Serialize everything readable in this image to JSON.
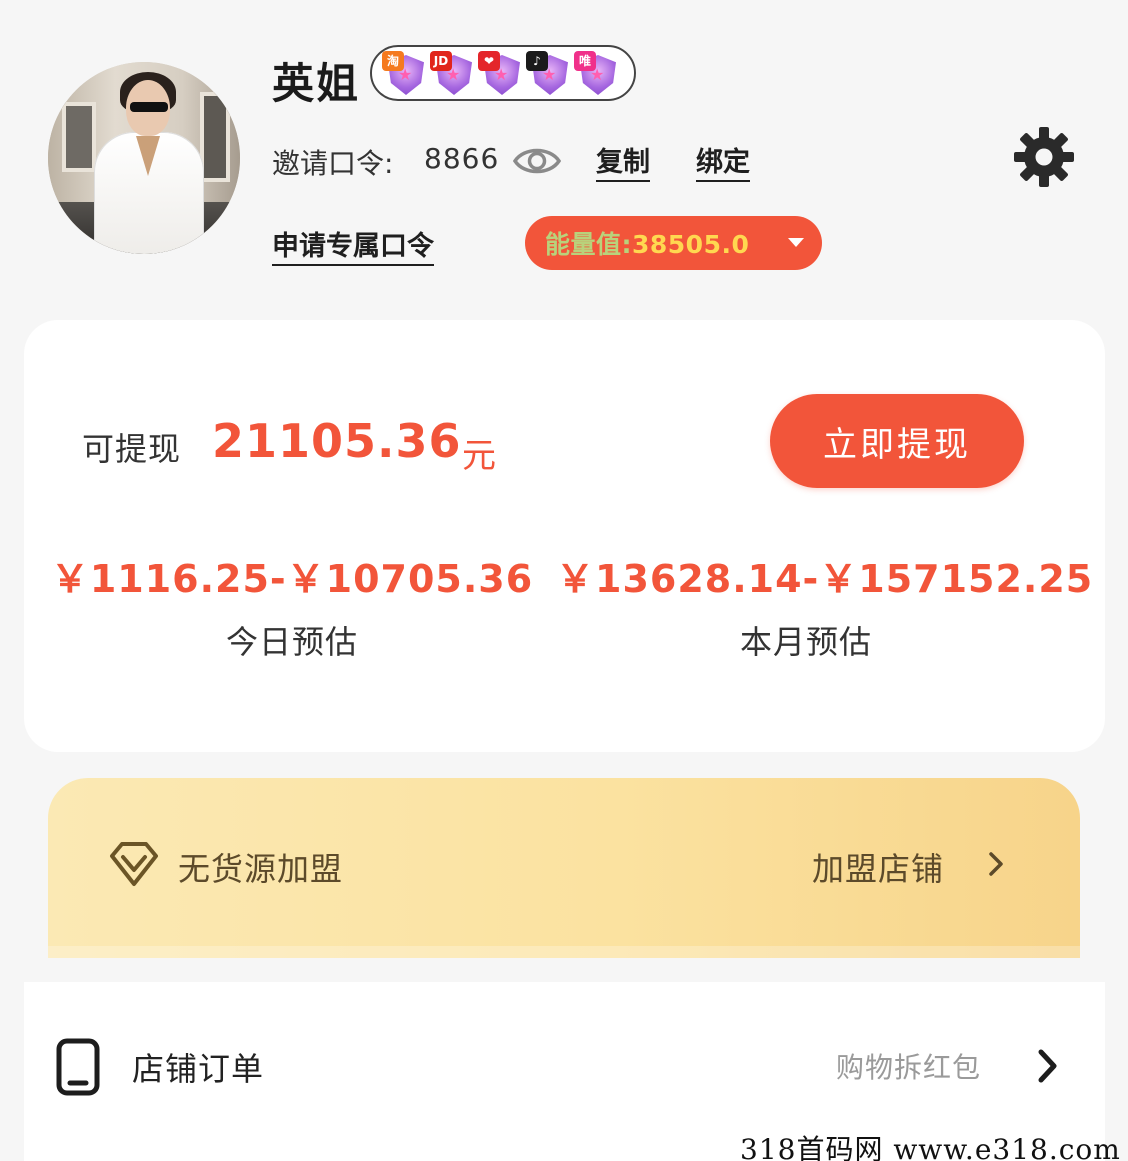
{
  "profile": {
    "name": "英姐",
    "platforms": [
      {
        "tag": "淘",
        "color": "#f57a1f",
        "icon": "taobao-badge"
      },
      {
        "tag": "JD",
        "color": "#e1251b",
        "icon": "jd-badge"
      },
      {
        "tag": "❤",
        "color": "#e4262b",
        "icon": "pinduoduo-badge"
      },
      {
        "tag": "♪",
        "color": "#1a1a1a",
        "icon": "douyin-badge"
      },
      {
        "tag": "唯",
        "color": "#f0308a",
        "icon": "vip-badge"
      }
    ],
    "invite_label": "邀请口令:",
    "invite_code": "8866",
    "copy_label": "复制",
    "bind_label": "绑定",
    "apply_label": "申请专属口令",
    "energy_label": "能量值:",
    "energy_value": "38505.0"
  },
  "earnings": {
    "withdraw_label": "可提现",
    "withdraw_amount": "21105.36",
    "withdraw_unit": "元",
    "withdraw_button": "立即提现",
    "today_value": "￥1116.25-￥10705.36",
    "today_label": "今日预估",
    "month_value": "￥13628.14-￥157152.25",
    "month_label": "本月预估"
  },
  "join": {
    "title": "无货源加盟",
    "link": "加盟店铺"
  },
  "orders": {
    "title": "店铺订单",
    "hint": "购物拆红包"
  },
  "watermark": "318首码网  www.e318.com",
  "colors": {
    "accent": "#f2553a",
    "energy_text": "#ffd850",
    "banner_start": "#fbe9b4",
    "banner_end": "#f7d48a"
  }
}
